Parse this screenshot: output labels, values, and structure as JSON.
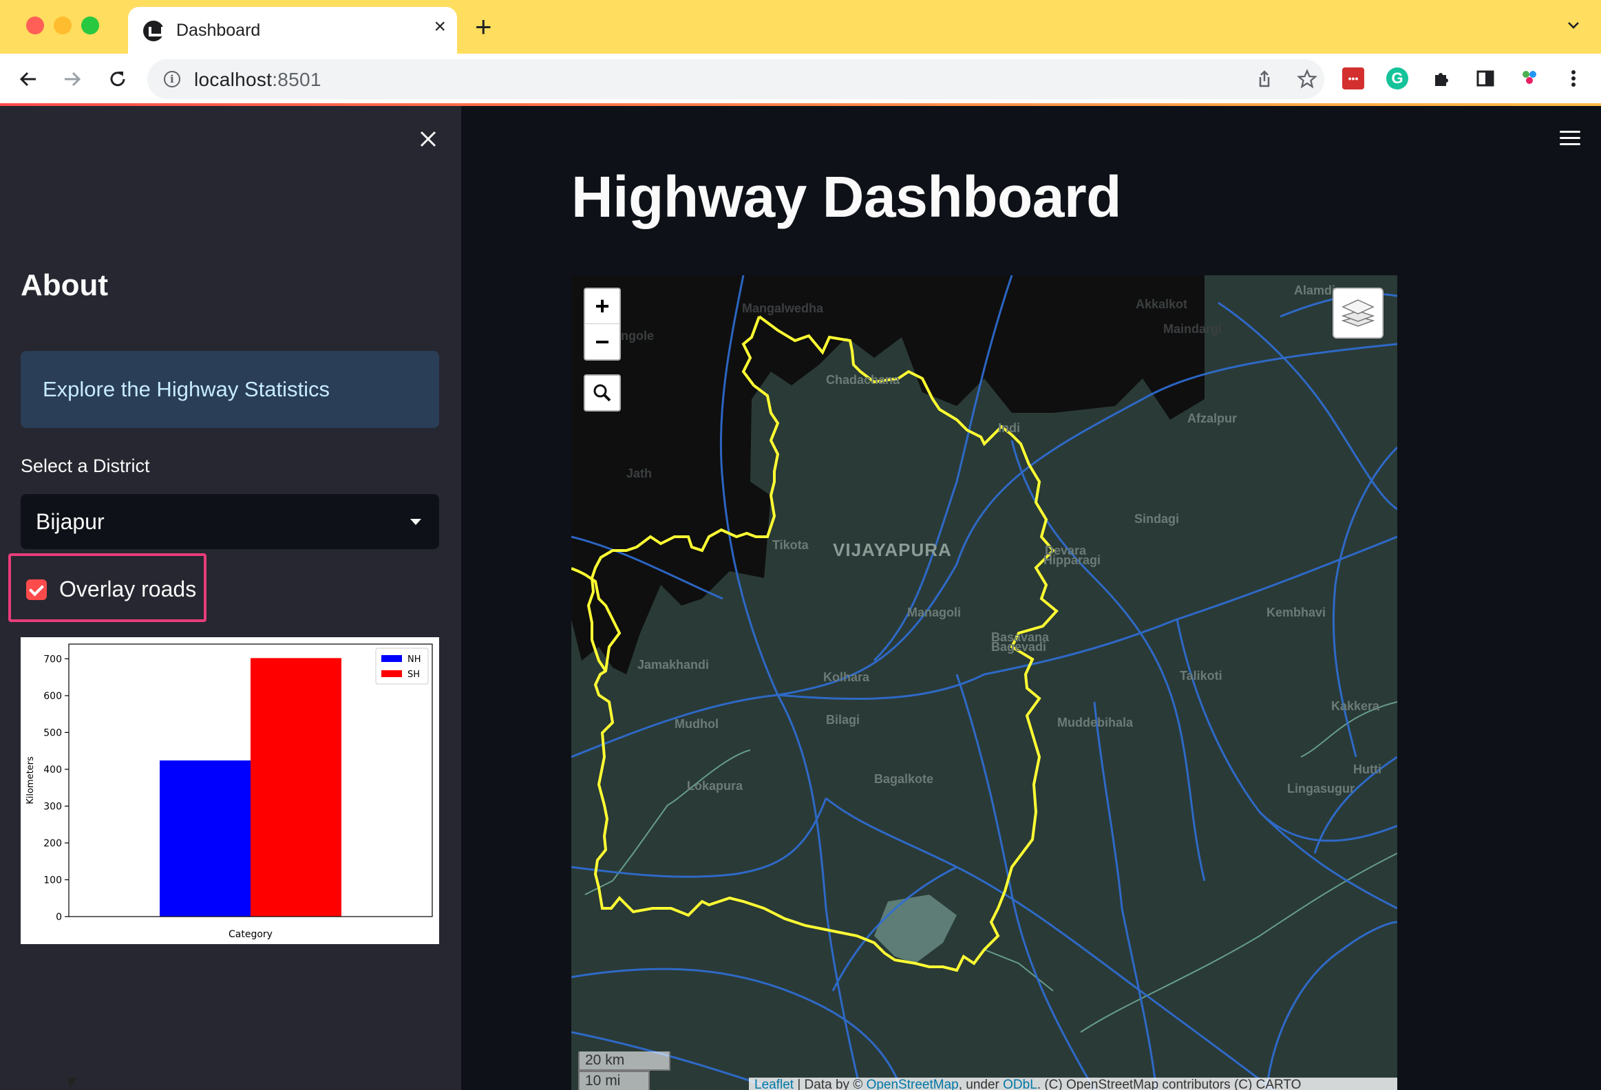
{
  "browser": {
    "tab_title": "Dashboard",
    "tab_close": "×",
    "new_tab": "+",
    "url_host": "localhost",
    "url_port": ":8501"
  },
  "sidebar": {
    "close": "×",
    "heading": "About",
    "info_text": "Explore the Highway Statistics",
    "select_label": "Select a District",
    "select_value": "Bijapur",
    "checkbox_label": "Overlay roads",
    "checkbox_checked": true
  },
  "main": {
    "title": "Highway Dashboard"
  },
  "map": {
    "zoom_in": "+",
    "zoom_out": "−",
    "scale_km": "20 km",
    "scale_mi": "10 mi",
    "attribution": {
      "leaflet": "Leaflet",
      "text1": " | Data by © ",
      "osm": "OpenStreetMap",
      "text2": ", under ",
      "odbl": "ODbL",
      "text3": ". (C) OpenStreetMap contributors (C) CARTO"
    },
    "labels": [
      {
        "text": "Mangalwedha",
        "cls": "dark"
      },
      {
        "text": "Akkalkot",
        "cls": "dark"
      },
      {
        "text": "Maindargi",
        "cls": "dark"
      },
      {
        "text": "Alamdi",
        "cls": ""
      },
      {
        "text": "Sangole",
        "cls": "dark"
      },
      {
        "text": "Chadachana",
        "cls": ""
      },
      {
        "text": "Indi",
        "cls": ""
      },
      {
        "text": "Afzalpur",
        "cls": ""
      },
      {
        "text": "Jath",
        "cls": "dark"
      },
      {
        "text": "Sindagi",
        "cls": ""
      },
      {
        "text": "Tikota",
        "cls": ""
      },
      {
        "text": "VIJAYAPURA",
        "cls": "big"
      },
      {
        "text": "Devara",
        "cls": ""
      },
      {
        "text": "Hipparagi",
        "cls": ""
      },
      {
        "text": "Kembhavi",
        "cls": ""
      },
      {
        "text": "Managoli",
        "cls": ""
      },
      {
        "text": "Basavana",
        "cls": ""
      },
      {
        "text": "Bagevadi",
        "cls": ""
      },
      {
        "text": "Jamakhandi",
        "cls": ""
      },
      {
        "text": "Talikoti",
        "cls": ""
      },
      {
        "text": "Kolhara",
        "cls": ""
      },
      {
        "text": "Mudhol",
        "cls": ""
      },
      {
        "text": "Bilagi",
        "cls": ""
      },
      {
        "text": "Muddebihala",
        "cls": ""
      },
      {
        "text": "Kakkera",
        "cls": ""
      },
      {
        "text": "Bagalkote",
        "cls": ""
      },
      {
        "text": "Lokapura",
        "cls": ""
      },
      {
        "text": "Hutti",
        "cls": ""
      },
      {
        "text": "Lingasugur",
        "cls": ""
      }
    ]
  },
  "chart_data": {
    "type": "bar",
    "categories": [
      "NH",
      "SH"
    ],
    "series": [
      {
        "name": "NH",
        "values": [
          424
        ],
        "color": "#0000ff"
      },
      {
        "name": "SH",
        "values": [
          702
        ],
        "color": "#ff0000"
      }
    ],
    "xlabel": "Category",
    "ylabel": "Kilometers",
    "ylim": [
      0,
      740
    ],
    "yticks": [
      0,
      100,
      200,
      300,
      400,
      500,
      600,
      700
    ],
    "legend": "top-right",
    "grid": false
  },
  "colors": {
    "accent": "#ff4b4b",
    "boundary": "#ffff33",
    "roads": "#2f6fd6",
    "sidebar_bg": "#262730",
    "main_bg": "#0e1117",
    "highlight_frame": "#e83d7a"
  }
}
